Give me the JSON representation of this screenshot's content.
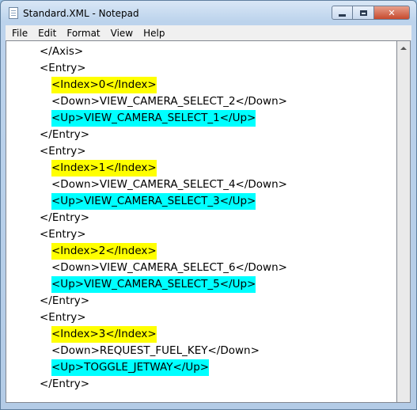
{
  "window": {
    "title": "Standard.XML - Notepad",
    "icon": "notepad-icon",
    "buttons": {
      "minimize": "minimize-icon",
      "maximize": "maximize-icon",
      "close": "✕"
    }
  },
  "menu": [
    "File",
    "Edit",
    "Format",
    "View",
    "Help"
  ],
  "colors": {
    "yellow_highlight": "#ffff00",
    "cyan_highlight": "#00ffff"
  },
  "lines": [
    {
      "text": "</Axis>",
      "indent": 1,
      "hl": ""
    },
    {
      "text": "<Entry>",
      "indent": 1,
      "hl": ""
    },
    {
      "text": "<Index>0</Index>",
      "indent": 2,
      "hl": "yellow"
    },
    {
      "text": "<Down>VIEW_CAMERA_SELECT_2</Down>",
      "indent": 2,
      "hl": ""
    },
    {
      "text": "<Up>VIEW_CAMERA_SELECT_1</Up>",
      "indent": 2,
      "hl": "cyan"
    },
    {
      "text": "</Entry>",
      "indent": 1,
      "hl": ""
    },
    {
      "text": "<Entry>",
      "indent": 1,
      "hl": ""
    },
    {
      "text": "<Index>1</Index>",
      "indent": 2,
      "hl": "yellow"
    },
    {
      "text": "<Down>VIEW_CAMERA_SELECT_4</Down>",
      "indent": 2,
      "hl": ""
    },
    {
      "text": "<Up>VIEW_CAMERA_SELECT_3</Up>",
      "indent": 2,
      "hl": "cyan"
    },
    {
      "text": "</Entry>",
      "indent": 1,
      "hl": ""
    },
    {
      "text": "<Entry>",
      "indent": 1,
      "hl": ""
    },
    {
      "text": "<Index>2</Index>",
      "indent": 2,
      "hl": "yellow"
    },
    {
      "text": "<Down>VIEW_CAMERA_SELECT_6</Down>",
      "indent": 2,
      "hl": ""
    },
    {
      "text": "<Up>VIEW_CAMERA_SELECT_5</Up>",
      "indent": 2,
      "hl": "cyan"
    },
    {
      "text": "</Entry>",
      "indent": 1,
      "hl": ""
    },
    {
      "text": "<Entry>",
      "indent": 1,
      "hl": ""
    },
    {
      "text": "<Index>3</Index>",
      "indent": 2,
      "hl": "yellow"
    },
    {
      "text": "<Down>REQUEST_FUEL_KEY</Down>",
      "indent": 2,
      "hl": ""
    },
    {
      "text": "<Up>TOGGLE_JETWAY</Up>",
      "indent": 2,
      "hl": "cyan"
    },
    {
      "text": "</Entry>",
      "indent": 1,
      "hl": ""
    }
  ]
}
